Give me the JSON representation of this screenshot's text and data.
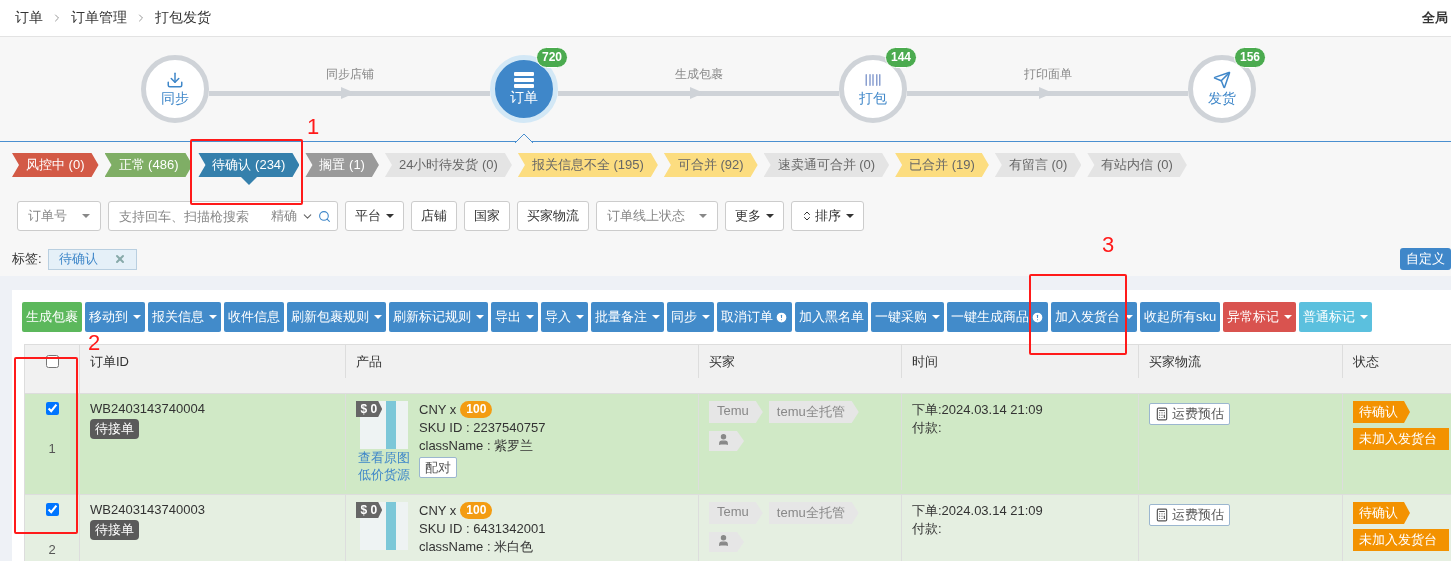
{
  "breadcrumb": [
    "订单",
    "订单管理",
    "打包发货"
  ],
  "global_label": "全局",
  "steps": [
    {
      "kind": "sync",
      "label": "同步",
      "selected": false,
      "link": "同步店铺"
    },
    {
      "kind": "order",
      "label": "订单",
      "selected": true,
      "badge": "720",
      "link": "生成包裹"
    },
    {
      "kind": "pack",
      "label": "打包",
      "selected": false,
      "badge": "144",
      "link": "打印面单"
    },
    {
      "kind": "ship",
      "label": "发货",
      "selected": false,
      "badge": "156"
    }
  ],
  "filters": [
    {
      "label": "风控中 (0)",
      "color": "#d35a46",
      "selected": false
    },
    {
      "label": "正常 (486)",
      "color": "#7fae65",
      "selected": false
    },
    {
      "label": "待确认 (234)",
      "color": "#3580ac",
      "selected": true
    },
    {
      "label": "搁置 (1)",
      "color": "#9a9a9a",
      "selected": false
    },
    {
      "label": "24小时待发货 (0)",
      "color": "#e4e4e4",
      "selected": false
    },
    {
      "label": "报关信息不全 (195)",
      "color": "#fcdd80",
      "selected": false
    },
    {
      "label": "可合并 (92)",
      "color": "#fcdd80",
      "selected": false
    },
    {
      "label": "速卖通可合并 (0)",
      "color": "#e4e4e4",
      "selected": false
    },
    {
      "label": "已合并 (19)",
      "color": "#fcdd80",
      "selected": false
    },
    {
      "label": "有留言 (0)",
      "color": "#e4e4e4",
      "selected": false
    },
    {
      "label": "有站内信 (0)",
      "color": "#e4e4e4",
      "selected": false
    }
  ],
  "search": {
    "field_select": {
      "placeholder": "订单号"
    },
    "query": {
      "placeholder": "支持回车、扫描枪搜索",
      "mode": "精确"
    },
    "filters": [
      {
        "kind": "button",
        "label": "平台",
        "dropdown": true
      },
      {
        "kind": "button",
        "label": "店铺",
        "dropdown": false
      },
      {
        "kind": "button",
        "label": "国家",
        "dropdown": false
      },
      {
        "kind": "button",
        "label": "买家物流",
        "dropdown": false
      },
      {
        "kind": "select",
        "label": "订单线上状态",
        "dropdown": true
      },
      {
        "kind": "button",
        "label": "更多",
        "dropdown": true
      },
      {
        "kind": "sort",
        "label": "排序",
        "dropdown": true
      }
    ]
  },
  "tag_bar": {
    "label": "标签:",
    "chips": [
      "待确认"
    ],
    "custom_button": "自定义"
  },
  "actions": [
    {
      "label": "生成包裹",
      "color": "#5cb85c",
      "dropdown": false,
      "alert": false
    },
    {
      "label": "移动到",
      "color": "#428bca",
      "dropdown": true,
      "alert": false
    },
    {
      "label": "报关信息",
      "color": "#428bca",
      "dropdown": true,
      "alert": false
    },
    {
      "label": "收件信息",
      "color": "#428bca",
      "dropdown": false,
      "alert": false
    },
    {
      "label": "刷新包裹规则",
      "color": "#428bca",
      "dropdown": true,
      "alert": false
    },
    {
      "label": "刷新标记规则",
      "color": "#428bca",
      "dropdown": true,
      "alert": false
    },
    {
      "label": "导出",
      "color": "#428bca",
      "dropdown": true,
      "alert": false
    },
    {
      "label": "导入",
      "color": "#428bca",
      "dropdown": true,
      "alert": false
    },
    {
      "label": "批量备注",
      "color": "#428bca",
      "dropdown": true,
      "alert": false
    },
    {
      "label": "同步",
      "color": "#428bca",
      "dropdown": true,
      "alert": false
    },
    {
      "label": "取消订单",
      "color": "#428bca",
      "dropdown": false,
      "alert": true
    },
    {
      "label": "加入黑名单",
      "color": "#428bca",
      "dropdown": false,
      "alert": false
    },
    {
      "label": "一键采购",
      "color": "#428bca",
      "dropdown": true,
      "alert": false
    },
    {
      "label": "一键生成商品",
      "color": "#428bca",
      "dropdown": false,
      "alert": true
    },
    {
      "label": "加入发货台",
      "color": "#428bca",
      "dropdown": true,
      "alert": false
    },
    {
      "label": "收起所有sku",
      "color": "#428bca",
      "dropdown": false,
      "alert": false
    },
    {
      "label": "异常标记",
      "color": "#d9534f",
      "dropdown": true,
      "alert": false
    },
    {
      "label": "普通标记",
      "color": "#5bc0de",
      "dropdown": true,
      "alert": false
    }
  ],
  "table": {
    "select_all": {
      "checked": false
    },
    "columns": [
      "订单ID",
      "产品",
      "买家",
      "时间",
      "买家物流",
      "状态"
    ],
    "rows": [
      {
        "index": "1",
        "checked": true,
        "highlighted": true,
        "order_id": "WB2403143740004",
        "order_tag": "待接单",
        "price": "$ 0",
        "currency": "CNY x",
        "qty": "100",
        "sku": "SKU ID : 2237540757",
        "class_name": "className : 紫罗兰",
        "links": [
          "查看原图",
          "低价货源"
        ],
        "pair_button": "配对",
        "buyer_tags": [
          "Temu",
          "temu全托管"
        ],
        "order_time": "下单:2024.03.14 21:09",
        "pay_time": "付款:",
        "logistics_button": "运费预估",
        "statuses": [
          "待确认",
          "未加入发货台"
        ]
      },
      {
        "index": "2",
        "checked": true,
        "highlighted": false,
        "order_id": "WB2403143740003",
        "order_tag": "待接单",
        "price": "$ 0",
        "currency": "CNY x",
        "qty": "100",
        "sku": "SKU ID : 6431342001",
        "class_name": "className : 米白色",
        "buyer_tags": [
          "Temu",
          "temu全托管"
        ],
        "order_time": "下单:2024.03.14 21:09",
        "pay_time": "付款:",
        "logistics_button": "运费预估",
        "statuses": [
          "待确认",
          "未加入发货台"
        ]
      }
    ]
  },
  "annotations": [
    {
      "label": "1"
    },
    {
      "label": "2"
    },
    {
      "label": "3"
    }
  ]
}
